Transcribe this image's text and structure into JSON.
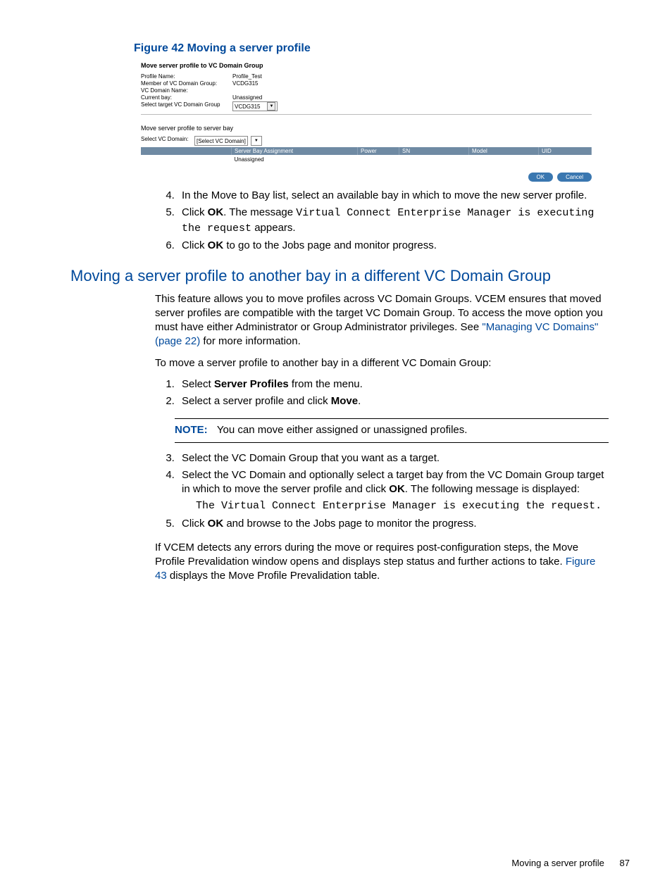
{
  "figure": {
    "caption": "Figure 42 Moving a server profile"
  },
  "screenshot": {
    "section1_title": "Move server profile to VC Domain Group",
    "rows": {
      "profile_name_label": "Profile Name:",
      "profile_name_value": "Profile_Test",
      "member_label": "Member of VC Domain Group:",
      "member_value": "VCDG315",
      "vcdomain_label": "VC Domain Name:",
      "vcdomain_value": "",
      "currentbay_label": "Current bay:",
      "currentbay_value": "Unassigned",
      "select_target_label": "Select target VC Domain Group",
      "select_target_value": "VCDG315"
    },
    "section2_title": "Move server profile to server bay",
    "select_vc_label": "Select VC Domain:",
    "select_vc_value": "[Select VC Domain]",
    "table": {
      "col_blank": "",
      "col_assignment": "Server Bay Assignment",
      "col_power": "Power",
      "col_sn": "SN",
      "col_model": "Model",
      "col_uid": "UID",
      "row_val": "Unassigned"
    },
    "btn_ok": "OK",
    "btn_cancel": "Cancel"
  },
  "steps_a": {
    "s4": "In the Move to Bay list, select an available bay in which to move the new server profile.",
    "s5_a": "Click ",
    "s5_b": "OK",
    "s5_c": ". The message ",
    "s5_d": "Virtual Connect Enterprise Manager is executing the request",
    "s5_e": " appears.",
    "s6_a": "Click ",
    "s6_b": "OK",
    "s6_c": " to go to the Jobs page and monitor progress."
  },
  "section_heading": "Moving a server profile to another bay in a different VC Domain Group",
  "intro": {
    "p1_a": "This feature allows you to move profiles across VC Domain Groups. VCEM ensures that moved server profiles are compatible with the target VC Domain Group. To access the move option you must have either Administrator or Group Administrator privileges. See ",
    "p1_link": "\"Managing VC Domains\" (page 22)",
    "p1_b": " for more information.",
    "p2": "To move a server profile to another bay in a different VC Domain Group:"
  },
  "steps_b": {
    "s1_a": "Select ",
    "s1_b": "Server Profiles",
    "s1_c": " from the menu.",
    "s2_a": "Select a server profile and click ",
    "s2_b": "Move",
    "s2_c": "."
  },
  "note": {
    "label": "NOTE:",
    "text": "You can move either assigned or unassigned profiles."
  },
  "steps_c": {
    "s3": "Select the VC Domain Group that you want as a target.",
    "s4_a": "Select the VC Domain and optionally select a target bay from the VC Domain Group target in which to move the server profile and click ",
    "s4_b": "OK",
    "s4_c": ". The following message is displayed:",
    "s4_msg": "The Virtual Connect Enterprise Manager is executing the request.",
    "s5_a": "Click ",
    "s5_b": "OK",
    "s5_c": " and browse to the Jobs page to monitor the progress."
  },
  "closing": {
    "a": "If VCEM detects any errors during the move or requires post-configuration steps, the Move Profile Prevalidation window opens and displays step status and further actions to take. ",
    "link": "Figure 43",
    "b": " displays the Move Profile Prevalidation table."
  },
  "footer": {
    "text": "Moving a server profile",
    "page": "87"
  }
}
